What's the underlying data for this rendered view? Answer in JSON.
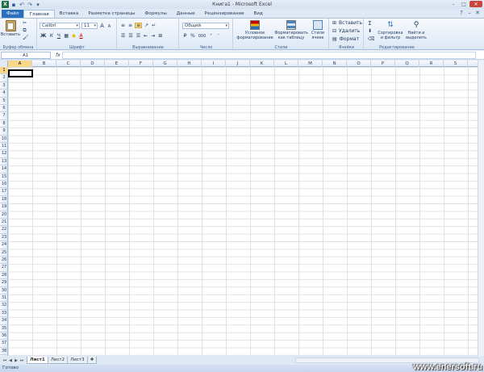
{
  "app": {
    "title": "Книга1 - Microsoft Excel",
    "logo": "X"
  },
  "tabs": [
    "Файл",
    "Главная",
    "Вставка",
    "Разметка страницы",
    "Формулы",
    "Данные",
    "Рецензирование",
    "Вид"
  ],
  "ribbon": {
    "clipboard": {
      "paste": "Вставить",
      "label": "Буфер обмена"
    },
    "font": {
      "name": "Calibri",
      "size": "11",
      "label": "Шрифт",
      "bold": "Ж",
      "italic": "К",
      "underline": "Ч",
      "grow": "A",
      "shrink": "A",
      "color_glyph": "A"
    },
    "alignment": {
      "label": "Выравнивание"
    },
    "number": {
      "format": "Общий",
      "label": "Число",
      "percent": "%",
      "comma": "000"
    },
    "styles": {
      "conditional": "Условное форматирование",
      "format_table": "Форматировать как таблицу",
      "cell_styles": "Стили ячеек",
      "label": "Стили"
    },
    "cells": {
      "insert": "Вставить",
      "delete": "Удалить",
      "format": "Формат",
      "label": "Ячейки"
    },
    "editing": {
      "sort": "Сортировка и фильтр",
      "find": "Найти и выделить",
      "label": "Редактирование",
      "sum": "Σ"
    }
  },
  "formula": {
    "namebox": "A1",
    "fx": "fx",
    "value": ""
  },
  "columns": [
    "A",
    "B",
    "C",
    "D",
    "E",
    "F",
    "G",
    "H",
    "I",
    "J",
    "K",
    "L",
    "M",
    "N",
    "O",
    "P",
    "Q",
    "R",
    "S"
  ],
  "rows": [
    "1",
    "2",
    "3",
    "4",
    "5",
    "6",
    "7",
    "8",
    "9",
    "10",
    "11",
    "12",
    "13",
    "14",
    "15",
    "16",
    "17",
    "18",
    "19",
    "20",
    "21",
    "22",
    "23",
    "24",
    "25",
    "26",
    "27",
    "28",
    "29",
    "30",
    "31",
    "32",
    "33",
    "34",
    "35",
    "36",
    "37",
    "38"
  ],
  "sheets": [
    "Лист1",
    "Лист2",
    "Лист3"
  ],
  "status": "Готово",
  "watermark": "www.enersoft.ru",
  "colors": {
    "file_tab": "#2b6fbc",
    "selected_header": "#f8d68a",
    "close": "#c9463d"
  }
}
